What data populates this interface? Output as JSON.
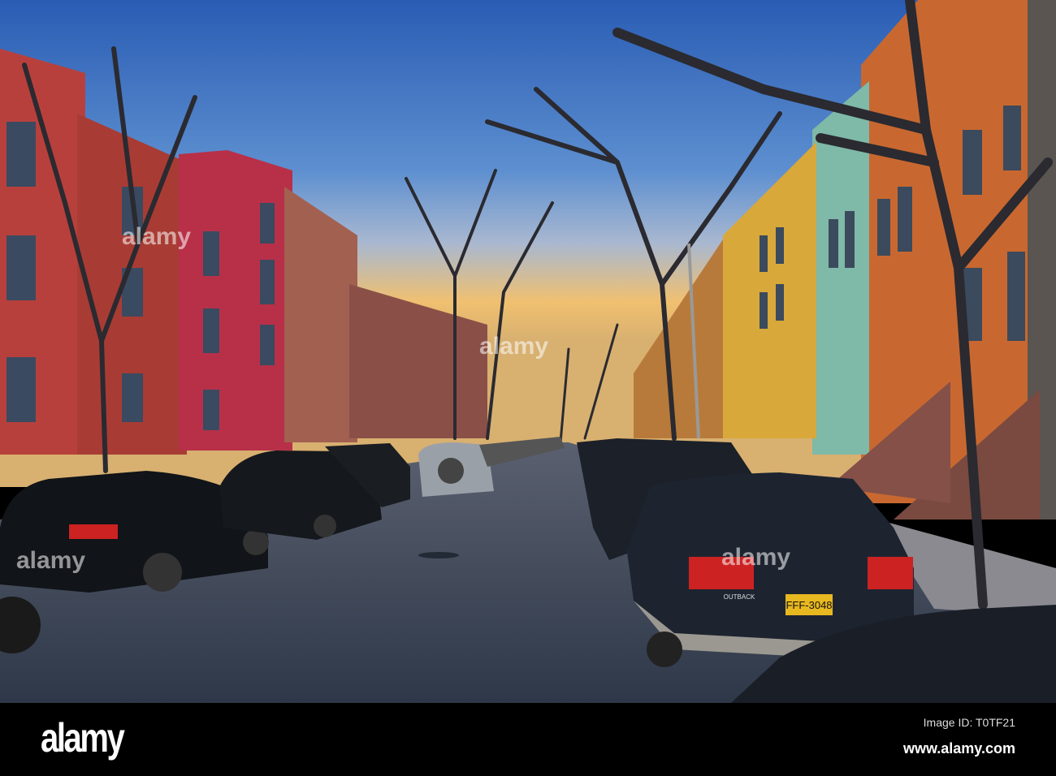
{
  "photo": {
    "subject": "tree-lined residential street with parked cars at sunset",
    "plate_text": "FFF-3048",
    "badge_text": "OUTBACK",
    "colors": {
      "sky_top": "#2f63b8",
      "sky_glow": "#f0c070",
      "road": "#34404f",
      "left_bricks": "#b8403c",
      "right_orange": "#d9772e",
      "right_yellow": "#d8a83a",
      "right_teal": "#7fb9a8"
    }
  },
  "watermark": {
    "text": "alamy"
  },
  "footer": {
    "logo": "alamy",
    "image_id": "Image ID: T0TF21",
    "website": "www.alamy.com"
  }
}
